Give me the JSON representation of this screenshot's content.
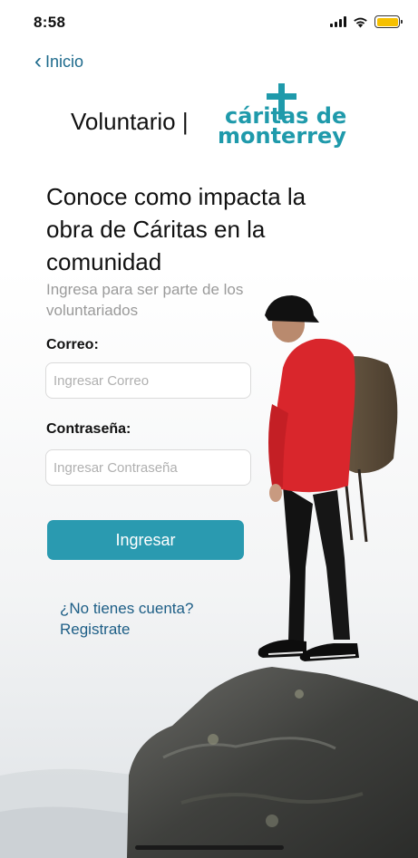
{
  "status_bar": {
    "time": "8:58",
    "battery_color": "#f6c000"
  },
  "nav": {
    "back_label": "Inicio",
    "back_icon": "chevron-left-icon"
  },
  "brand": {
    "prefix": "Voluntario |",
    "logo_line1": "cáritas de",
    "logo_line2": "monterrey",
    "logo_color": "#1f9aab"
  },
  "headline": "Conoce como impacta la obra de Cáritas en la comunidad",
  "subhead": "Ingresa para ser parte de los voluntariados",
  "form": {
    "email_label": "Correo:",
    "email_placeholder": "Ingresar Correo",
    "email_value": "",
    "password_label": "Contraseña:",
    "password_placeholder": "Ingresar Contraseña",
    "password_value": "",
    "submit_label": "Ingresar",
    "submit_color": "#2a9ab0"
  },
  "register": {
    "line1": "¿No tienes cuenta?",
    "line2": "Registrate",
    "color": "#1d5e86"
  }
}
